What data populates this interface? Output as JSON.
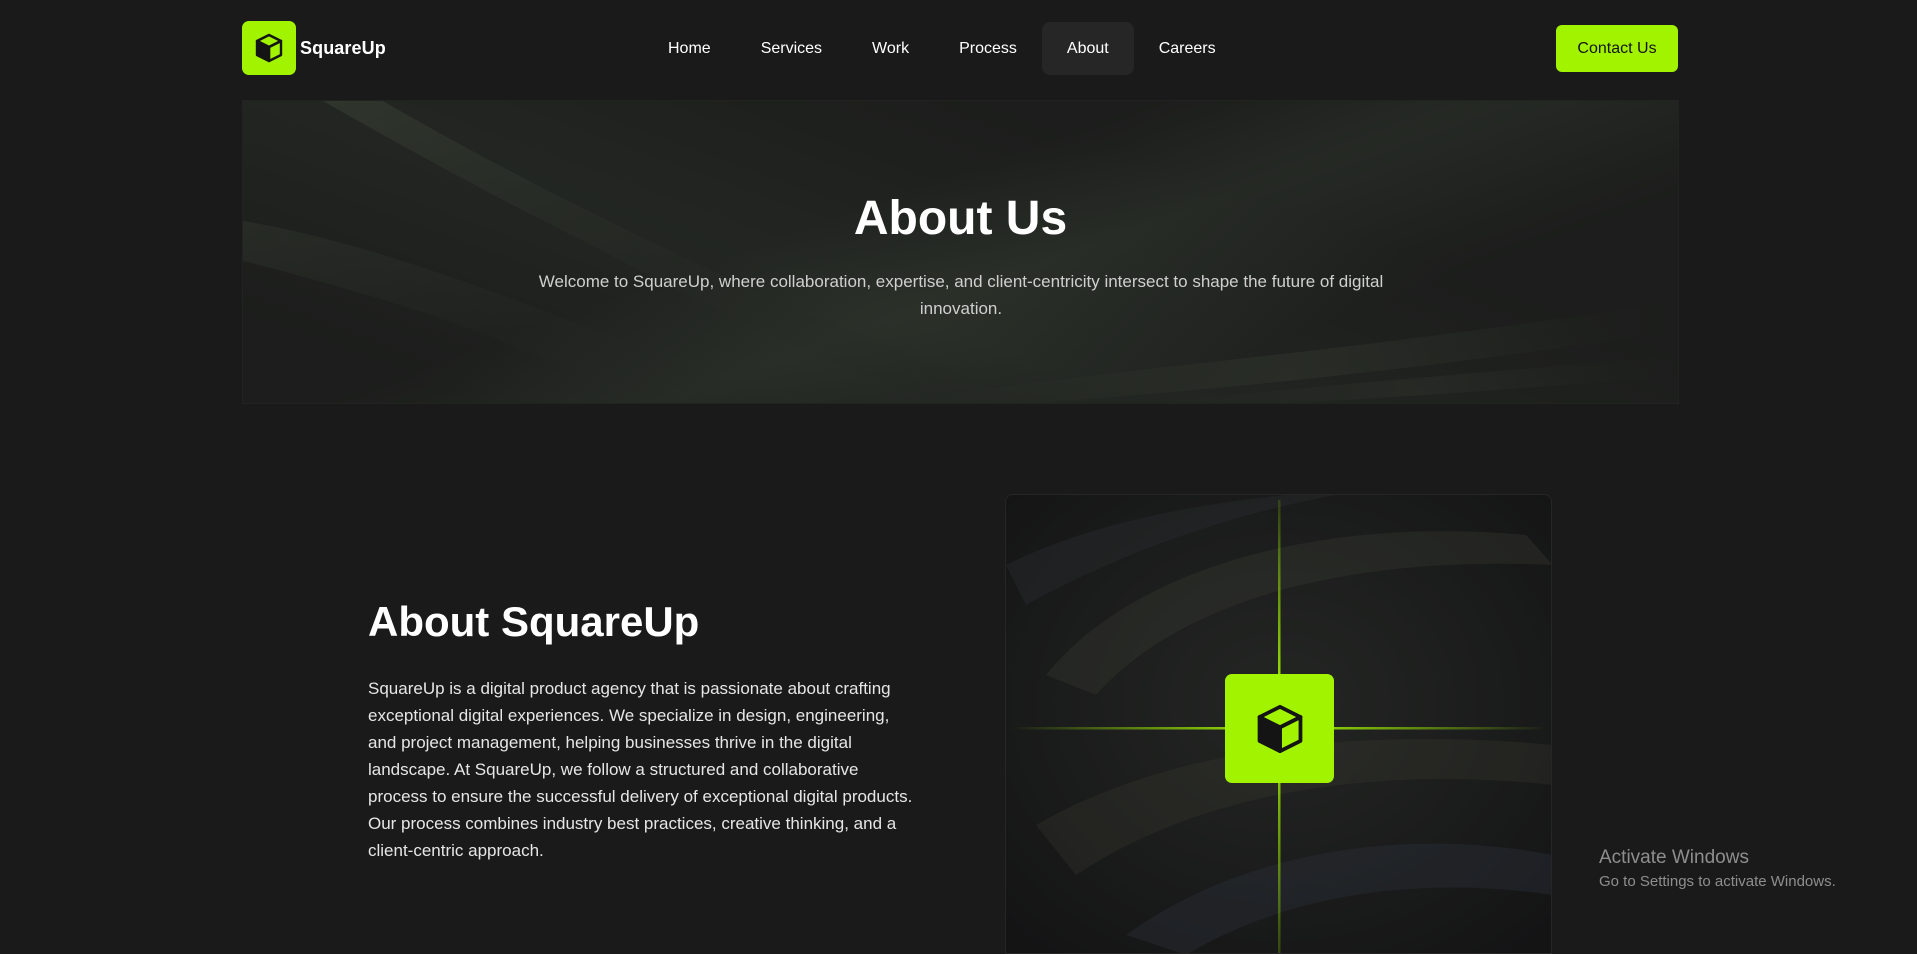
{
  "brand": {
    "name": "SquareUp",
    "accent_color": "#a2f300",
    "logo_icon": "cube-icon"
  },
  "nav": {
    "items": [
      {
        "label": "Home",
        "active": false
      },
      {
        "label": "Services",
        "active": false
      },
      {
        "label": "Work",
        "active": false
      },
      {
        "label": "Process",
        "active": false
      },
      {
        "label": "About",
        "active": true
      },
      {
        "label": "Careers",
        "active": false
      }
    ],
    "contact_label": "Contact Us"
  },
  "hero": {
    "title": "About Us",
    "subtitle": "Welcome to SquareUp, where collaboration, expertise, and client-centricity intersect to shape the future of digital innovation."
  },
  "about": {
    "title": "About SquareUp",
    "body": "SquareUp is a digital product agency that is passionate about crafting exceptional digital experiences. We specialize in design, engineering, and project management, helping businesses thrive in the digital landscape. At SquareUp, we follow a structured and collaborative process to ensure the successful delivery of exceptional digital products. Our process combines industry best practices, creative thinking, and a client-centric approach."
  },
  "watermark": {
    "title": "Activate Windows",
    "subtitle": "Go to Settings to activate Windows."
  }
}
